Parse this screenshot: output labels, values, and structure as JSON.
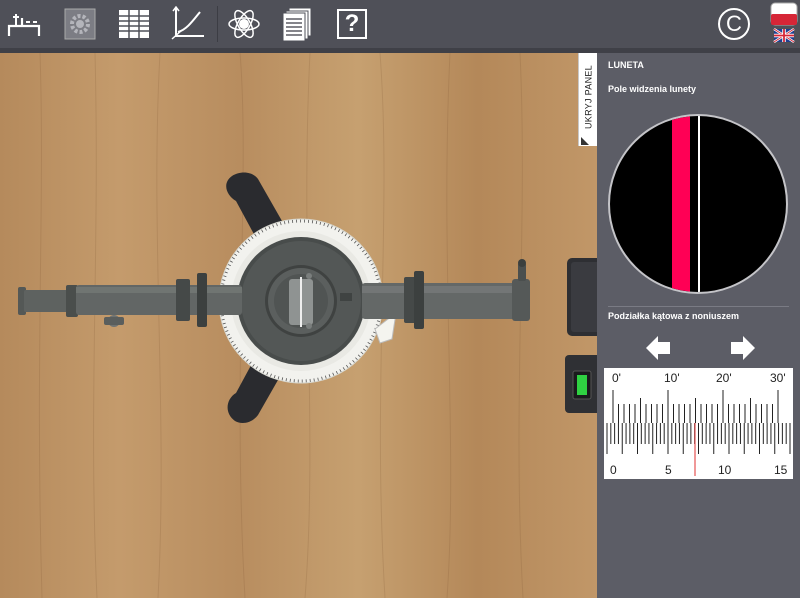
{
  "toolbar": {
    "items": [
      {
        "name": "setup-icon"
      },
      {
        "name": "settings-icon"
      },
      {
        "name": "table-icon"
      },
      {
        "name": "graph-icon"
      },
      {
        "name": "atom-icon"
      },
      {
        "name": "documents-icon"
      },
      {
        "name": "help-icon",
        "label": "?"
      }
    ],
    "copyright_label": "©",
    "languages": [
      "pl",
      "en"
    ]
  },
  "workspace": {
    "hide_panel_label": "UKRYJ PANEL"
  },
  "panel": {
    "title": "LUNETA",
    "field_of_view_label": "Pole widzenia lunety",
    "vernier_label": "Podziałka kątowa z noniuszem",
    "colors": {
      "background": "#5c5d66",
      "spectral_line": "#ff0055",
      "crosshair": "#ffffff",
      "view_field": "#000000"
    },
    "vernier": {
      "top_labels": [
        "0'",
        "10'",
        "20'",
        "30'"
      ],
      "bottom_labels": [
        "0",
        "5",
        "10",
        "15"
      ],
      "marker_color": "#e03030"
    }
  }
}
